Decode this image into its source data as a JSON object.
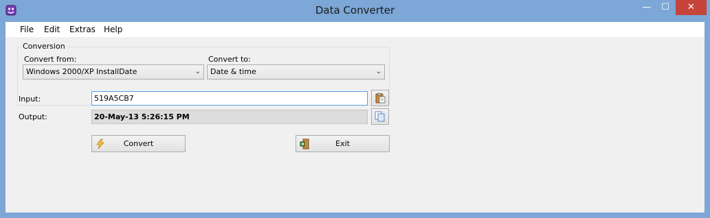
{
  "window": {
    "title": "Data Converter",
    "controls": {
      "minimize": "—",
      "maximize": "☐",
      "close": "✕"
    }
  },
  "menu": {
    "items": [
      "File",
      "Edit",
      "Extras",
      "Help"
    ]
  },
  "conversion": {
    "group_title": "Conversion",
    "from_label": "Convert from:",
    "from_value": "Windows 2000/XP InstallDate",
    "to_label": "Convert to:",
    "to_value": "Date & time"
  },
  "input": {
    "label": "Input:",
    "value": "519A5CB7"
  },
  "output": {
    "label": "Output:",
    "value": "20-May-13 5:26:15 PM"
  },
  "buttons": {
    "convert": "Convert",
    "exit": "Exit"
  },
  "icons": {
    "app": "app-icon",
    "paste": "paste-icon",
    "copy": "copy-icon",
    "convert": "lightning-icon",
    "exit": "exit-door-icon"
  },
  "colors": {
    "titlebar": "#7ca7d6",
    "close": "#c7443a",
    "focus_border": "#569de5"
  }
}
